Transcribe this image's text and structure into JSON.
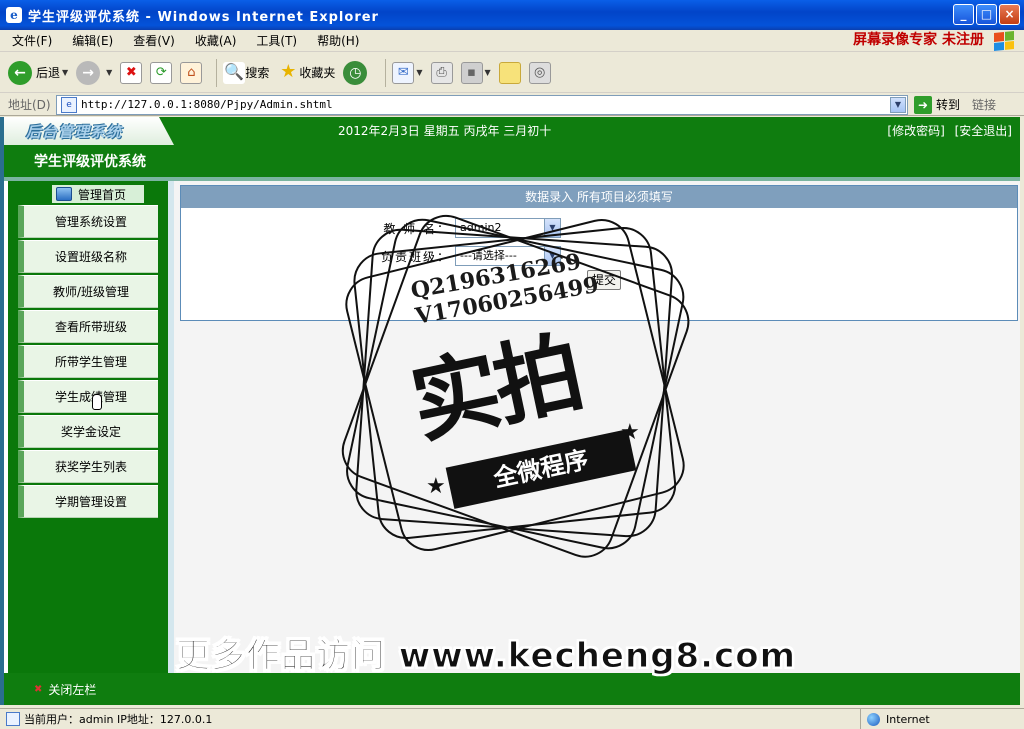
{
  "window": {
    "title": "学生评级评优系统 - Windows Internet Explorer",
    "controls": {
      "minimize": "_",
      "maximize": "□",
      "close": "×"
    }
  },
  "menu": {
    "items": [
      "文件(F)",
      "编辑(E)",
      "查看(V)",
      "收藏(A)",
      "工具(T)",
      "帮助(H)"
    ],
    "recorder_badge": "屏幕录像专家  未注册"
  },
  "toolbar": {
    "back_label": "后退",
    "search_label": "搜索",
    "favorites_label": "收藏夹"
  },
  "address": {
    "label": "地址(D)",
    "url": "http://127.0.0.1:8080/Pjpy/Admin.shtml",
    "go_label": "转到",
    "links_label": "链接"
  },
  "header": {
    "logo_text": "后台管理系统",
    "date_text": "2012年2月3日  星期五  丙戌年  三月初十",
    "change_password": "[修改密码]",
    "logout": "[安全退出]",
    "system_name": "学生评级评优系统"
  },
  "sidebar": {
    "title": "管理首页",
    "items": [
      "管理系统设置",
      "设置班级名称",
      "教师/班级管理",
      "查看所带班级",
      "所带学生管理",
      "学生成绩管理",
      "奖学金设定",
      "获奖学生列表",
      "学期管理设置"
    ]
  },
  "form": {
    "header": "数据录入  所有项目必须填写",
    "teacher_label": "教 师 名：",
    "teacher_value": "admin2",
    "class_label": "负责班级：",
    "class_value": "---请选择---",
    "submit_label": "提交"
  },
  "footer": {
    "close_left": "关闭左栏"
  },
  "status": {
    "left": "当前用户：admin  IP地址：127.0.0.1",
    "zone": "Internet"
  },
  "watermark": {
    "contact_q": "Q2196316269",
    "contact_v": "V17060256499",
    "big_text": "实拍",
    "ribbon_text": "全微程序",
    "bottom_text": "更多作品访问 www.kecheng8.com"
  }
}
